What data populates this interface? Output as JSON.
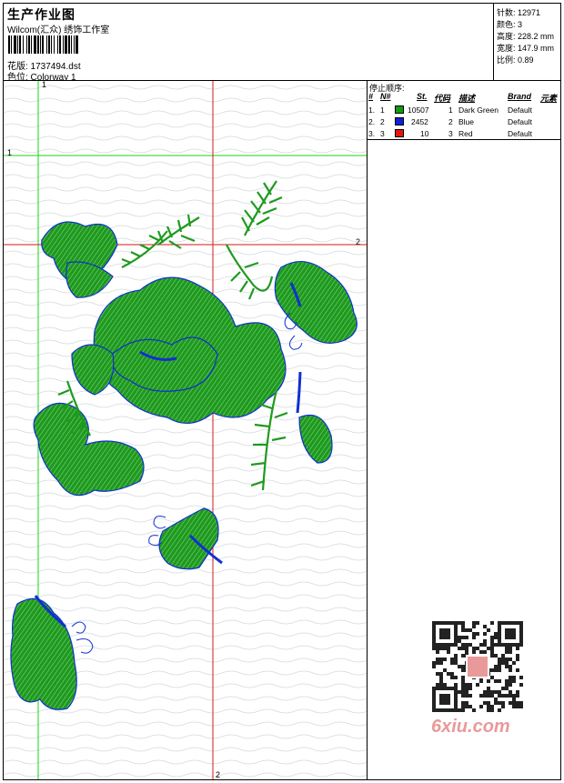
{
  "header": {
    "title": "生产作业图",
    "subtitle": "Wilcom(汇众) 绣饰工作室",
    "design_file": "花版:  1737494.dst",
    "colorway": "色位:  Colorway 1"
  },
  "info": {
    "stitches": "针数:  12971",
    "colors": "颜色:  3",
    "height": "高度:  228.2 mm",
    "width": "宽度:  147.9 mm",
    "scale": "比例:  0.89"
  },
  "guides": {
    "v1": "1",
    "h1": "1",
    "h2": "2",
    "v2": "2"
  },
  "table": {
    "stop_label": "停止顺序:",
    "headers": {
      "num": "#",
      "n": "N#",
      "st": "St.",
      "code": "代码",
      "desc": "描述",
      "brand": "Brand",
      "elem": "元素"
    },
    "rows": [
      {
        "num": "1.",
        "n": "1",
        "color": "#109a10",
        "st": "10507",
        "code": "1",
        "desc": "Dark Green",
        "brand": "Default"
      },
      {
        "num": "2.",
        "n": "2",
        "color": "#0f1fd6",
        "st": "2452",
        "code": "2",
        "desc": "Blue",
        "brand": "Default"
      },
      {
        "num": "3.",
        "n": "3",
        "color": "#e8140c",
        "st": "10",
        "code": "3",
        "desc": "Red",
        "brand": "Default"
      }
    ]
  },
  "watermark": "6xiu.com",
  "colors": {
    "green": "#1e9a1e",
    "blue": "#1030d0",
    "guide_green": "#19d419",
    "guide_red": "#d41919"
  }
}
